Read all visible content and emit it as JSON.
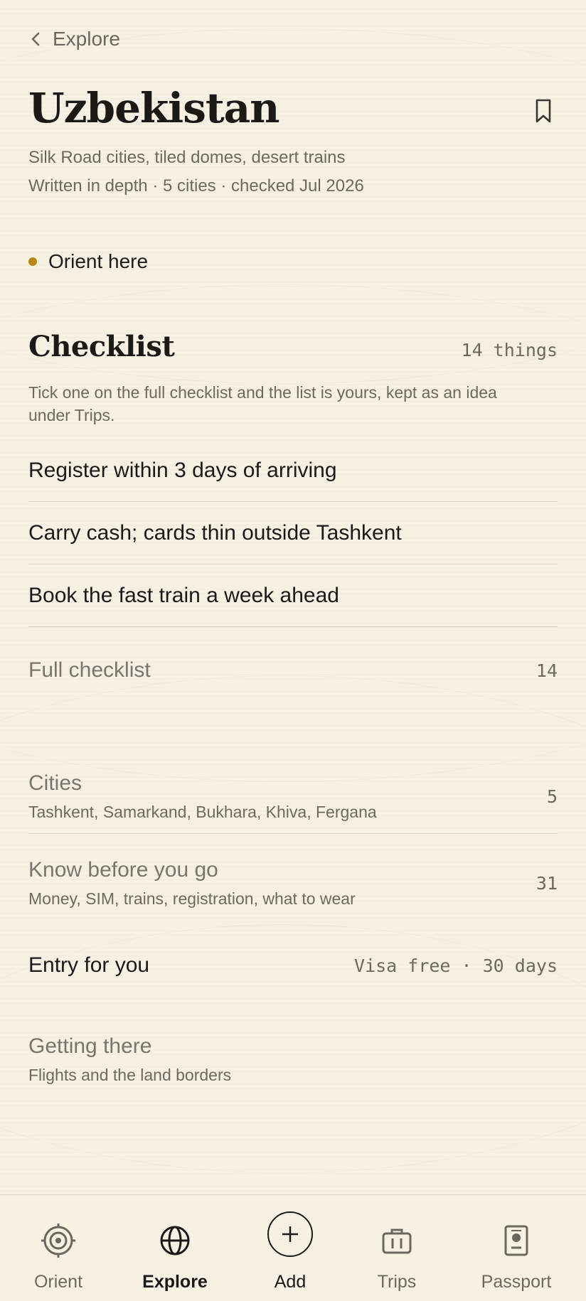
{
  "header": {
    "back_label": "Explore",
    "title": "Uzbekistan",
    "subtitle": "Silk Road cities, tiled domes, desert trains",
    "meta": "Written in depth · 5 cities · checked Jul 2026"
  },
  "orient": {
    "label": "Orient here",
    "dot_color": "#b8860b"
  },
  "checklist": {
    "title": "Checklist",
    "count": "14 things",
    "description": "Tick one on the full checklist and the list is yours, kept as an idea under Trips.",
    "items": [
      "Register within 3 days of arriving",
      "Carry cash; cards thin outside Tashkent",
      "Book the fast train a week ahead"
    ],
    "full_label": "Full checklist",
    "full_count": "14"
  },
  "sections": {
    "cities": {
      "title": "Cities",
      "subtitle": "Tashkent, Samarkand, Bukhara, Khiva, Fergana",
      "count": "5"
    },
    "know": {
      "title": "Know before you go",
      "subtitle": "Money, SIM, trains, registration, what to wear",
      "count": "31"
    },
    "entry": {
      "label": "Entry for you",
      "value": "Visa free · 30 days"
    },
    "getting_there": {
      "title": "Getting there",
      "subtitle": "Flights and the land borders"
    }
  },
  "nav": {
    "items": [
      {
        "label": "Orient",
        "icon": "target-icon"
      },
      {
        "label": "Explore",
        "icon": "globe-icon",
        "active": true
      },
      {
        "label": "Add",
        "icon": "plus-circle-icon"
      },
      {
        "label": "Trips",
        "icon": "briefcase-icon"
      },
      {
        "label": "Passport",
        "icon": "passport-icon"
      }
    ]
  }
}
